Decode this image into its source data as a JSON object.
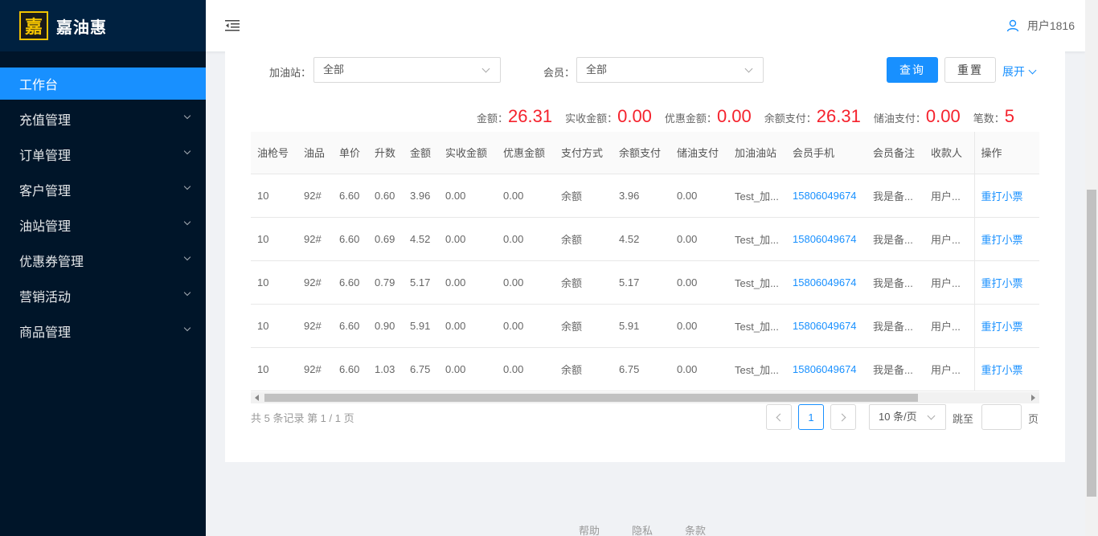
{
  "brand": {
    "logo_char": "嘉",
    "name": "嘉油惠"
  },
  "sidebar": {
    "items": [
      {
        "label": "工作台"
      },
      {
        "label": "充值管理"
      },
      {
        "label": "订单管理"
      },
      {
        "label": "客户管理"
      },
      {
        "label": "油站管理"
      },
      {
        "label": "优惠券管理"
      },
      {
        "label": "营销活动"
      },
      {
        "label": "商品管理"
      }
    ]
  },
  "header": {
    "user_name": "用户1816"
  },
  "filters": {
    "station_label": "加油站：",
    "station_value": "全部",
    "member_label": "会员：",
    "member_value": "全部",
    "search_label": "查询",
    "reset_label": "重置",
    "expand_label": "展开"
  },
  "summary": {
    "amount_label": "金额：",
    "amount": "26.31",
    "received_label": "实收金额：",
    "received": "0.00",
    "discount_label": "优惠金额：",
    "discount": "0.00",
    "balance_label": "余额支付：",
    "balance": "26.31",
    "stored_label": "储油支付：",
    "stored": "0.00",
    "count_label": "笔数：",
    "count": "5"
  },
  "table": {
    "columns": [
      "油枪号",
      "油品",
      "单价",
      "升数",
      "金额",
      "实收金额",
      "优惠金额",
      "支付方式",
      "余额支付",
      "储油支付",
      "加油油站",
      "会员手机",
      "会员备注",
      "收款人",
      "操作"
    ],
    "rows": [
      [
        "10",
        "92#",
        "6.60",
        "0.60",
        "3.96",
        "0.00",
        "0.00",
        "余额",
        "3.96",
        "0.00",
        "Test_加...",
        "15806049674",
        "我是备...",
        "用户...",
        "重打小票"
      ],
      [
        "10",
        "92#",
        "6.60",
        "0.69",
        "4.52",
        "0.00",
        "0.00",
        "余额",
        "4.52",
        "0.00",
        "Test_加...",
        "15806049674",
        "我是备...",
        "用户...",
        "重打小票"
      ],
      [
        "10",
        "92#",
        "6.60",
        "0.79",
        "5.17",
        "0.00",
        "0.00",
        "余额",
        "5.17",
        "0.00",
        "Test_加...",
        "15806049674",
        "我是备...",
        "用户...",
        "重打小票"
      ],
      [
        "10",
        "92#",
        "6.60",
        "0.90",
        "5.91",
        "0.00",
        "0.00",
        "余额",
        "5.91",
        "0.00",
        "Test_加...",
        "15806049674",
        "我是备...",
        "用户...",
        "重打小票"
      ],
      [
        "10",
        "92#",
        "6.60",
        "1.03",
        "6.75",
        "0.00",
        "0.00",
        "余额",
        "6.75",
        "0.00",
        "Test_加...",
        "15806049674",
        "我是备...",
        "用户...",
        "重打小票"
      ]
    ]
  },
  "pagination": {
    "records_text": "共 5 条记录 第 1 / 1 页",
    "current_page": "1",
    "page_size": "10 条/页",
    "jump_label": "跳至",
    "page_suffix": "页"
  },
  "footer": {
    "links": [
      "帮助",
      "隐私",
      "条款"
    ]
  },
  "colors": {
    "primary": "#1890ff",
    "sidebar_bg": "#001529",
    "highlight": "#f5222d"
  }
}
